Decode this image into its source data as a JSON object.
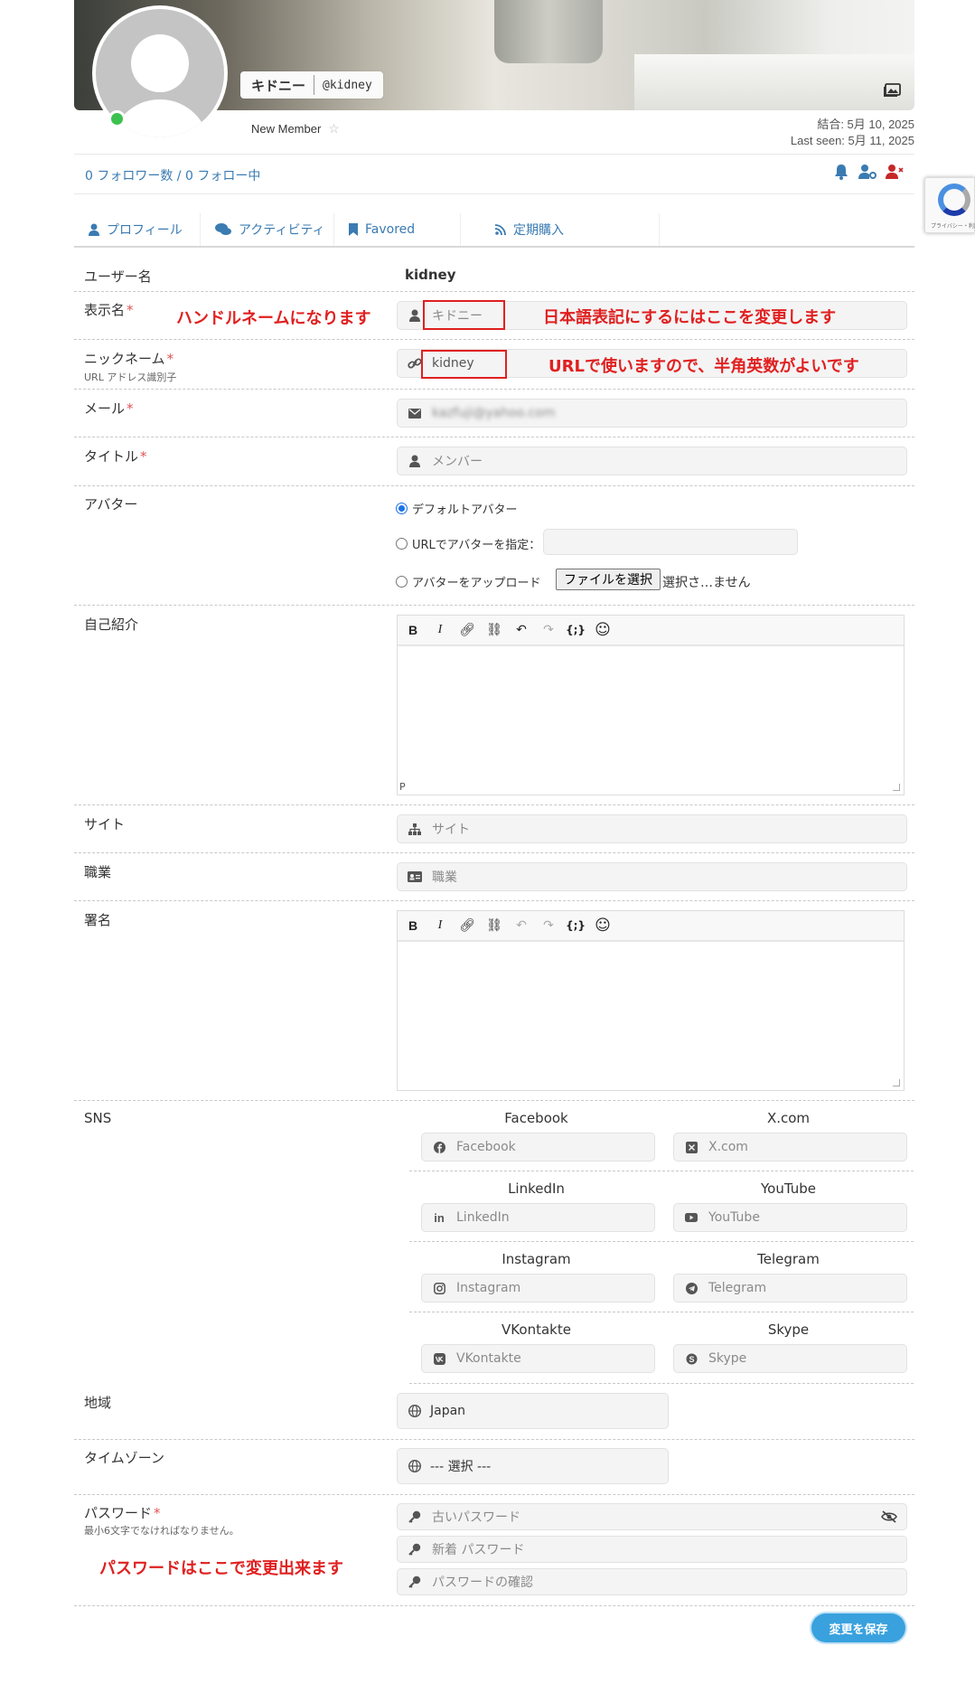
{
  "profile": {
    "display_name": "キドニー",
    "username": "@kidney",
    "member_level": "New Member",
    "joined": "結合: 5月 10, 2025",
    "last_seen": "Last seen: 5月 11, 2025",
    "follow_counts": "0 フォロワー数 / 0 フォロー中"
  },
  "recaptcha": {
    "text": "プライバシー・利用規約"
  },
  "tabs": [
    {
      "label": "プロフィール",
      "icon": "user-icon"
    },
    {
      "label": "アクティビティ",
      "icon": "comments-icon"
    },
    {
      "label": "Favored",
      "icon": "bookmark-icon"
    },
    {
      "label": "定期購入",
      "icon": "rss-icon"
    }
  ],
  "form": {
    "username": {
      "label": "ユーザー名",
      "value": "kidney"
    },
    "display_name": {
      "label": "表示名",
      "required": "*",
      "value": "キドニー"
    },
    "nickname": {
      "label": "ニックネーム",
      "required": "*",
      "sublabel": "URL アドレス識別子",
      "value": "kidney"
    },
    "email": {
      "label": "メール",
      "required": "*",
      "value": "kazfuji@yahoo.com"
    },
    "title": {
      "label": "タイトル",
      "required": "*",
      "value": "メンバー"
    },
    "avatar": {
      "label": "アバター",
      "option_default": "デフォルトアバター",
      "option_url": "URLでアバターを指定：",
      "option_upload": "アバターをアップロード",
      "file_button": "ファイルを選択",
      "file_status": "選択さ…ません"
    },
    "about": {
      "label": "自己紹介",
      "status": "P"
    },
    "site": {
      "label": "サイト",
      "placeholder": "サイト"
    },
    "occupation": {
      "label": "職業",
      "placeholder": "職業"
    },
    "signature": {
      "label": "署名"
    },
    "sns": {
      "label": "SNS",
      "items": [
        {
          "heading": "Facebook",
          "placeholder": "Facebook",
          "icon": "facebook-icon"
        },
        {
          "heading": "X.com",
          "placeholder": "X.com",
          "icon": "x-icon"
        },
        {
          "heading": "LinkedIn",
          "placeholder": "LinkedIn",
          "icon": "linkedin-icon"
        },
        {
          "heading": "YouTube",
          "placeholder": "YouTube",
          "icon": "youtube-icon"
        },
        {
          "heading": "Instagram",
          "placeholder": "Instagram",
          "icon": "instagram-icon"
        },
        {
          "heading": "Telegram",
          "placeholder": "Telegram",
          "icon": "telegram-icon"
        },
        {
          "heading": "VKontakte",
          "placeholder": "VKontakte",
          "icon": "vk-icon"
        },
        {
          "heading": "Skype",
          "placeholder": "Skype",
          "icon": "skype-icon"
        }
      ]
    },
    "location": {
      "label": "地域",
      "value": "Japan"
    },
    "timezone": {
      "label": "タイムゾーン",
      "value": "--- 選択 ---"
    },
    "password": {
      "label": "パスワード",
      "required": "*",
      "sublabel": "最小6文字でなければなりません。",
      "old_placeholder": "古いパスワード",
      "new_placeholder": "新着 パスワード",
      "confirm_placeholder": "パスワードの確認"
    },
    "save_label": "変更を保存"
  },
  "annotations": {
    "display_name_left": "ハンドルネームになります",
    "display_name_right": "日本語表記にするにはここを変更します",
    "nickname_right": "URLで使いますので、半角英数がよいです",
    "password_note": "パスワードはここで変更出来ます"
  },
  "colors": {
    "link": "#3a7bb2",
    "accent_red": "#e02020",
    "save_button": "#39a1de",
    "online": "#3cc14f"
  }
}
